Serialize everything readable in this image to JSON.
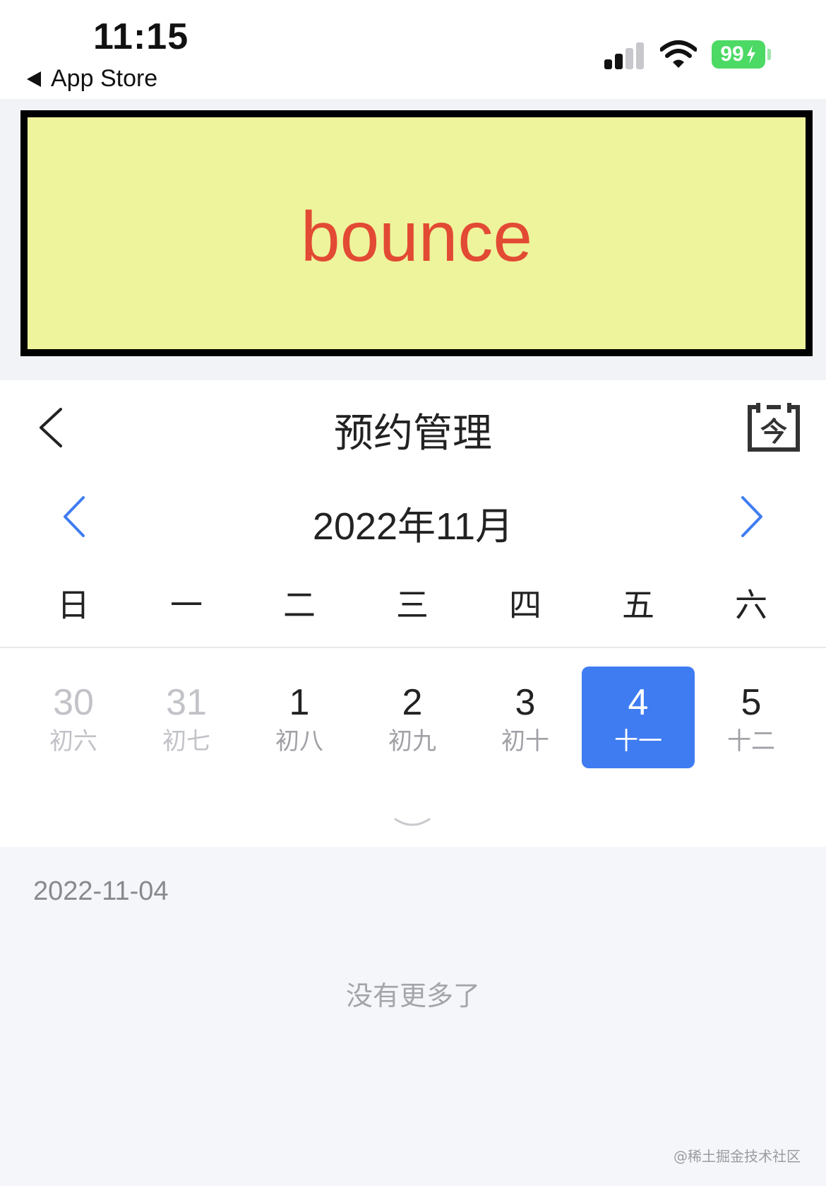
{
  "status_bar": {
    "time": "11:15",
    "back_app": "App Store",
    "battery": "99"
  },
  "banner": {
    "text": "bounce",
    "text_color": "#e24a34",
    "background": "#eef49b"
  },
  "nav": {
    "title": "预约管理",
    "today_glyph": "今"
  },
  "calendar": {
    "month_title": "2022年11月",
    "weekdays": [
      "日",
      "一",
      "二",
      "三",
      "四",
      "五",
      "六"
    ],
    "days": [
      {
        "num": "30",
        "lunar": "初六",
        "state": "muted"
      },
      {
        "num": "31",
        "lunar": "初七",
        "state": "muted"
      },
      {
        "num": "1",
        "lunar": "初八",
        "state": "normal"
      },
      {
        "num": "2",
        "lunar": "初九",
        "state": "normal"
      },
      {
        "num": "3",
        "lunar": "初十",
        "state": "normal"
      },
      {
        "num": "4",
        "lunar": "十一",
        "state": "selected"
      },
      {
        "num": "5",
        "lunar": "十二",
        "state": "normal"
      }
    ],
    "accent": "#3f7cf2"
  },
  "list": {
    "date": "2022-11-04",
    "empty_text": "没有更多了"
  },
  "watermark": "@稀土掘金技术社区"
}
